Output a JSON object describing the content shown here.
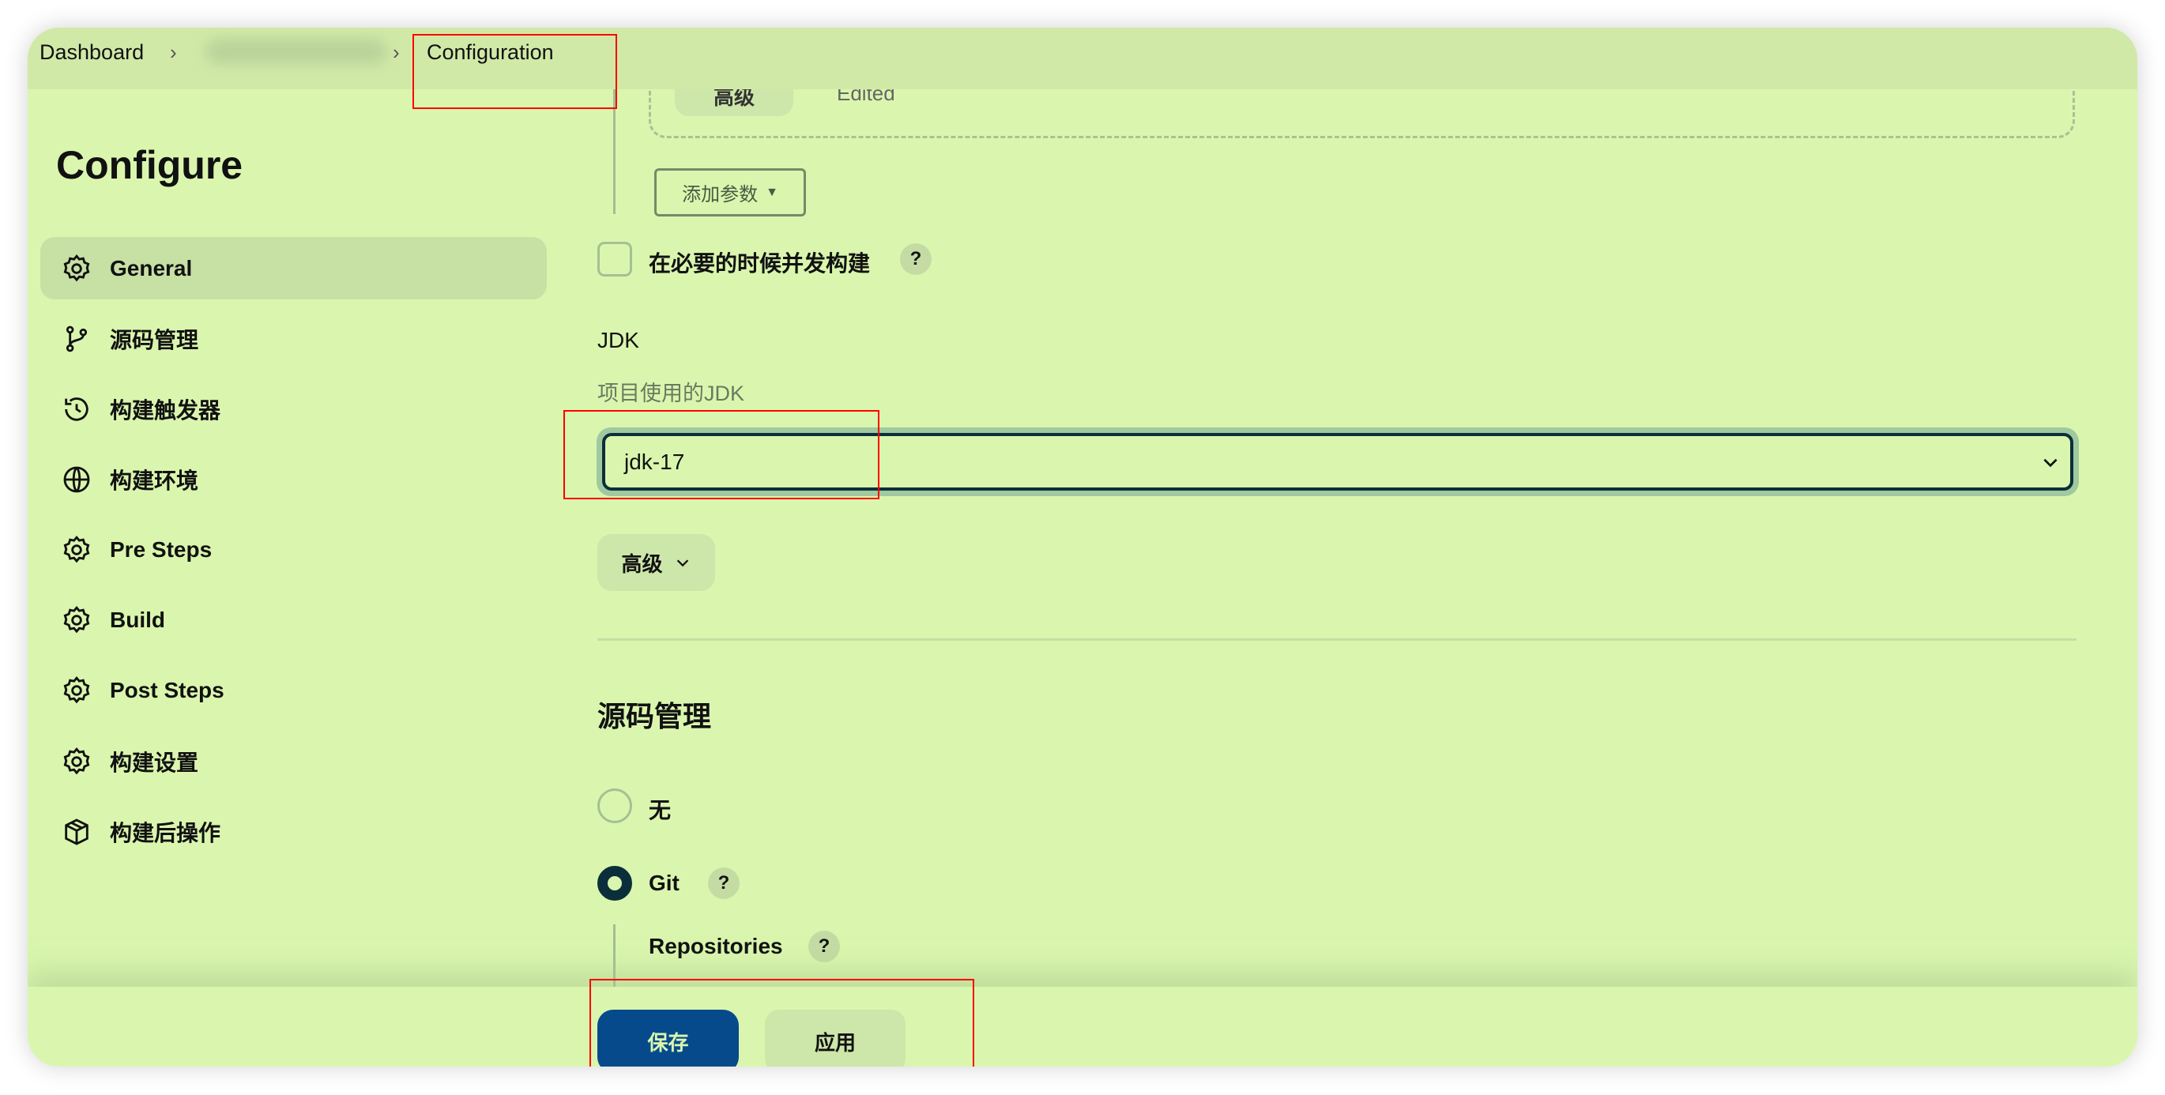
{
  "breadcrumb": {
    "items": [
      "Dashboard",
      "Configuration"
    ]
  },
  "sidebar": {
    "title": "Configure",
    "items": [
      {
        "label": "General",
        "icon": "gear-icon",
        "active": true
      },
      {
        "label": "源码管理",
        "icon": "branch-icon"
      },
      {
        "label": "构建触发器",
        "icon": "clock-icon"
      },
      {
        "label": "构建环境",
        "icon": "globe-icon"
      },
      {
        "label": "Pre Steps",
        "icon": "gear-icon"
      },
      {
        "label": "Build",
        "icon": "gear-icon"
      },
      {
        "label": "Post Steps",
        "icon": "gear-icon"
      },
      {
        "label": "构建设置",
        "icon": "gear-icon"
      },
      {
        "label": "构建后操作",
        "icon": "package-icon"
      }
    ]
  },
  "main": {
    "hidden_button": "高级",
    "hidden_edited": "Edited",
    "add_param": "添加参数",
    "concurrent": {
      "label": "在必要的时候并发构建",
      "checked": false,
      "help": "?"
    },
    "jdk": {
      "title": "JDK",
      "description": "项目使用的JDK",
      "value": "jdk-17"
    },
    "advanced": "高级",
    "scm": {
      "title": "源码管理",
      "options": [
        {
          "label": "无",
          "selected": false
        },
        {
          "label": "Git",
          "selected": true
        }
      ],
      "help": "?",
      "repositories": "Repositories"
    }
  },
  "footer": {
    "save": "保存",
    "apply": "应用"
  },
  "colors": {
    "background": "#daf6ae",
    "primary": "#064a8c",
    "dark": "#0b2f3a",
    "annotation": "#ff0000"
  }
}
